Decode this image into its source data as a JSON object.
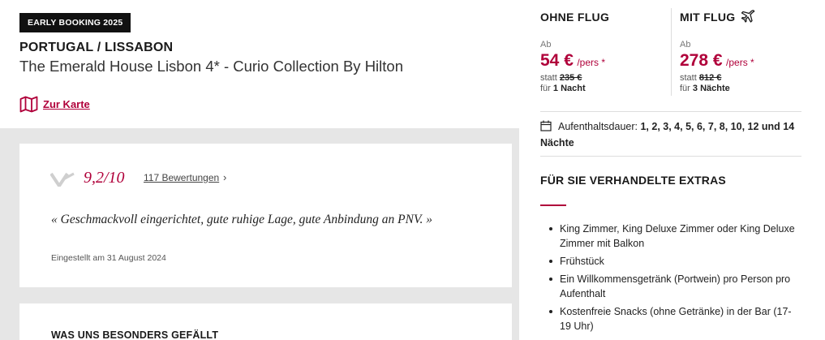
{
  "badge": "EARLY BOOKING 2025",
  "location": "PORTUGAL / LISSABON",
  "hotel_name": "The Emerald House Lisbon 4* - Curio Collection By Hilton",
  "map_link": {
    "label": "Zur Karte",
    "icon": "map-icon"
  },
  "pricing": {
    "without_flight": {
      "title": "OHNE FLUG",
      "prefix": "Ab",
      "price": "54 €",
      "per": "/pers *",
      "statt_label": "statt",
      "old_price": "235 €",
      "nights_label": "für",
      "nights": "1 Nacht"
    },
    "with_flight": {
      "title": "MIT FLUG",
      "icon": "plane-icon",
      "prefix": "Ab",
      "price": "278 €",
      "per": "/pers *",
      "statt_label": "statt",
      "old_price": "812 €",
      "nights_label": "für",
      "nights": "3 Nächte"
    }
  },
  "stay": {
    "label": "Aufenthaltsdauer:",
    "values": "1, 2, 3, 4, 5, 6, 7, 8, 10, 12 und 14 Nächte",
    "icon": "calendar-icon"
  },
  "extras": {
    "title": "FÜR SIE VERHANDELTE EXTRAS",
    "items": [
      "King Zimmer, King Deluxe Zimmer oder King Deluxe Zimmer mit Balkon",
      "Frühstück",
      "Ein Willkommensgetränk (Portwein) pro Person pro Aufenthalt",
      "Kostenfreie Snacks (ohne Getränke) in der Bar (17-19 Uhr)"
    ]
  },
  "review": {
    "score": "9,2/10",
    "count_link": "117 Bewertungen",
    "chevron": "›",
    "quote": "« Geschmackvoll eingerichtet, gute ruhige Lage, gute Anbindung an PNV. »",
    "posted": "Eingestellt am 31 August 2024"
  },
  "section2_title": "WAS UNS BESONDERS GEFÄLLT",
  "colors": {
    "accent": "#b0003a",
    "band": "#e6e6e6",
    "badge_bg": "#111111"
  }
}
